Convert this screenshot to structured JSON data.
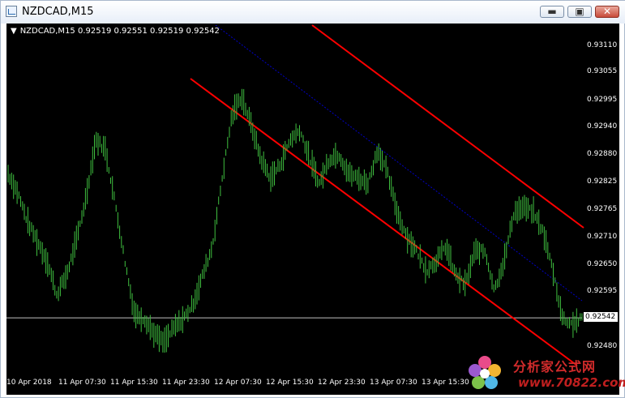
{
  "window": {
    "title": "NZDCAD,M15",
    "buttons": {
      "minimize": "▬",
      "maximize": "▣",
      "close": "✕"
    }
  },
  "chart_info": "NZDCAD,M15  0.92519 0.92551 0.92519 0.92542",
  "current_price": "0.92542",
  "colors": {
    "background": "#000000",
    "bars": "#3fbf3f",
    "channel_lines": "#ff0000",
    "mid_line": "#0000c8",
    "price_line": "#c0c0c0"
  },
  "watermark": {
    "cn": "分析家公式网",
    "url": "www.70822.com"
  },
  "chart_data": {
    "type": "bar",
    "symbol": "NZDCAD",
    "timeframe": "M15",
    "y_ticks": [
      "0.93110",
      "0.93055",
      "0.92995",
      "0.92940",
      "0.92880",
      "0.92825",
      "0.92765",
      "0.92710",
      "0.92650",
      "0.92595",
      "0.92480"
    ],
    "x_ticks": [
      "10 Apr 2018",
      "11 Apr 07:30",
      "11 Apr 15:30",
      "11 Apr 23:30",
      "12 Apr 07:30",
      "12 Apr 15:30",
      "12 Apr 23:30",
      "13 Apr 07:30",
      "13 Apr 15:30"
    ],
    "ylim": [
      0.9243,
      0.9315
    ],
    "close_path": [
      0.9284,
      0.928,
      0.9274,
      0.927,
      0.9266,
      0.9259,
      0.9263,
      0.927,
      0.9279,
      0.9291,
      0.9289,
      0.9278,
      0.9266,
      0.9255,
      0.9254,
      0.9251,
      0.9249,
      0.9252,
      0.9254,
      0.9257,
      0.9263,
      0.9269,
      0.9283,
      0.9296,
      0.93,
      0.9294,
      0.9287,
      0.9283,
      0.9286,
      0.9291,
      0.9293,
      0.9287,
      0.9282,
      0.9287,
      0.9288,
      0.9284,
      0.9283,
      0.9282,
      0.9289,
      0.9284,
      0.9276,
      0.9271,
      0.9268,
      0.9264,
      0.9266,
      0.9269,
      0.9263,
      0.9261,
      0.9268,
      0.9268,
      0.926,
      0.9266,
      0.9276,
      0.9277,
      0.9276,
      0.9272,
      0.9264,
      0.9254,
      0.9253,
      0.9254
    ],
    "current_price": 0.92542
  }
}
